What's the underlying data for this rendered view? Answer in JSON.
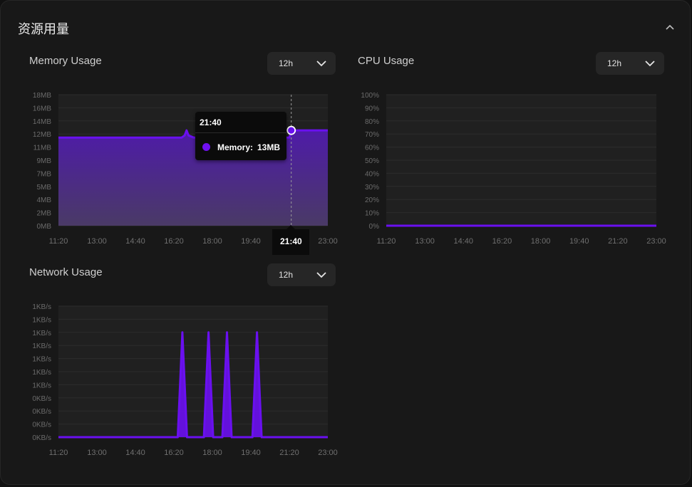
{
  "section": {
    "title": "资源用量"
  },
  "icons": {
    "collapse": "chevron-up-icon",
    "dropdown": "chevron-down-icon"
  },
  "colors": {
    "series": "#6a10f0",
    "plot_bg": "#202020",
    "grid": "#2c2c2c"
  },
  "memory": {
    "title": "Memory Usage",
    "range": "12h",
    "tooltip": {
      "time": "21:40",
      "label": "Memory:",
      "value": "13MB"
    },
    "pointer_label": "21:40"
  },
  "cpu": {
    "title": "CPU Usage",
    "range": "12h"
  },
  "network": {
    "title": "Network Usage",
    "range": "12h"
  },
  "chart_data": [
    {
      "id": "memory",
      "type": "area",
      "title": "Memory Usage",
      "y_ticks": [
        "0MB",
        "2MB",
        "4MB",
        "5MB",
        "7MB",
        "9MB",
        "11MB",
        "12MB",
        "14MB",
        "16MB",
        "18MB"
      ],
      "x_ticks": [
        "11:20",
        "13:00",
        "14:40",
        "16:20",
        "18:00",
        "19:40",
        "21:20",
        "23:00"
      ],
      "xlim": [
        0,
        700
      ],
      "ylim": [
        0,
        18
      ],
      "series": [
        {
          "name": "Memory",
          "x": [
            0,
            320,
            328,
            333,
            338,
            352,
            600,
            605,
            700
          ],
          "y": [
            12.1,
            12.1,
            12.4,
            13.1,
            12.4,
            12.1,
            12.1,
            13.1,
            13.1
          ]
        }
      ],
      "highlight": {
        "x": 605,
        "y": 13.1,
        "label": "21:40"
      }
    },
    {
      "id": "cpu",
      "type": "line",
      "title": "CPU Usage",
      "y_ticks": [
        "0%",
        "10%",
        "20%",
        "30%",
        "40%",
        "50%",
        "60%",
        "70%",
        "80%",
        "90%",
        "100%"
      ],
      "x_ticks": [
        "11:20",
        "13:00",
        "14:40",
        "16:20",
        "18:00",
        "19:40",
        "21:20",
        "23:00"
      ],
      "xlim": [
        0,
        700
      ],
      "ylim": [
        0,
        100
      ],
      "series": [
        {
          "name": "CPU",
          "x": [
            0,
            700
          ],
          "y": [
            0,
            0
          ]
        }
      ]
    },
    {
      "id": "network",
      "type": "line",
      "title": "Network Usage",
      "y_ticks": [
        "0KB/s",
        "0KB/s",
        "0KB/s",
        "0KB/s",
        "1KB/s",
        "1KB/s",
        "1KB/s",
        "1KB/s",
        "1KB/s",
        "1KB/s",
        "1KB/s"
      ],
      "x_ticks": [
        "11:20",
        "13:00",
        "14:40",
        "16:20",
        "18:00",
        "19:40",
        "21:20",
        "23:00"
      ],
      "xlim": [
        0,
        700
      ],
      "ylim": [
        0,
        10
      ],
      "series": [
        {
          "name": "Network",
          "x": [
            0,
            310,
            322,
            334,
            378,
            390,
            402,
            426,
            438,
            450,
            504,
            516,
            528,
            700
          ],
          "y": [
            0,
            0,
            8,
            0,
            0,
            8,
            0,
            0,
            8,
            0,
            0,
            8,
            0,
            0
          ]
        }
      ]
    }
  ]
}
